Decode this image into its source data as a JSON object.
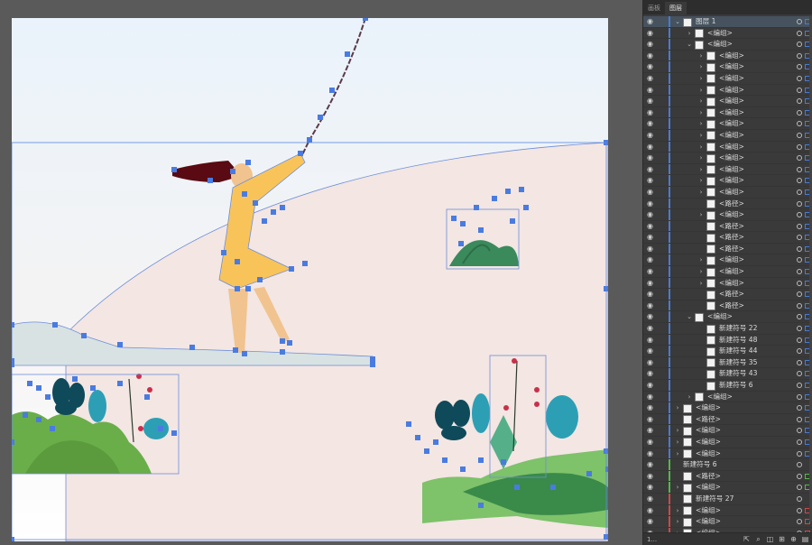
{
  "panel": {
    "tabs": [
      {
        "label": "画板",
        "active": false
      },
      {
        "label": "图层",
        "active": true
      }
    ],
    "footer": {
      "count": "1...",
      "icons": [
        "export-icon",
        "search-icon",
        "clipping-mask-icon",
        "sublayer-icon",
        "new-layer-icon",
        "delete-icon"
      ]
    }
  },
  "layers": [
    {
      "name": "图层 1",
      "indent": 0,
      "expand": "open",
      "thumb": true,
      "sel": true,
      "color": "#4a7bd0",
      "selcolor": "#4a7bd0"
    },
    {
      "name": "<编组>",
      "indent": 1,
      "expand": "closed",
      "thumb": true,
      "color": "#4a7bd0",
      "selcolor": "#4a7bd0"
    },
    {
      "name": "<编组>",
      "indent": 1,
      "expand": "open",
      "thumb": true,
      "color": "#4a7bd0",
      "selcolor": "#4a7bd0"
    },
    {
      "name": "<编组>",
      "indent": 2,
      "expand": "closed",
      "thumb": true,
      "color": "#4a7bd0",
      "selcolor": "#4a7bd0"
    },
    {
      "name": "<编组>",
      "indent": 2,
      "expand": "closed",
      "thumb": true,
      "color": "#4a7bd0",
      "selcolor": "#4a7bd0"
    },
    {
      "name": "<编组>",
      "indent": 2,
      "expand": "closed",
      "thumb": true,
      "color": "#4a7bd0",
      "selcolor": "#4a7bd0"
    },
    {
      "name": "<编组>",
      "indent": 2,
      "expand": "closed",
      "thumb": true,
      "color": "#4a7bd0",
      "selcolor": "#4a7bd0"
    },
    {
      "name": "<编组>",
      "indent": 2,
      "expand": "closed",
      "thumb": true,
      "color": "#4a7bd0",
      "selcolor": "#4a7bd0"
    },
    {
      "name": "<编组>",
      "indent": 2,
      "expand": "closed",
      "thumb": true,
      "color": "#4a7bd0",
      "selcolor": "#4a7bd0"
    },
    {
      "name": "<编组>",
      "indent": 2,
      "expand": "closed",
      "thumb": true,
      "color": "#4a7bd0",
      "selcolor": "#4a7bd0"
    },
    {
      "name": "<编组>",
      "indent": 2,
      "expand": "closed",
      "thumb": true,
      "color": "#4a7bd0",
      "selcolor": "#4a7bd0"
    },
    {
      "name": "<编组>",
      "indent": 2,
      "expand": "closed",
      "thumb": true,
      "color": "#4a7bd0",
      "selcolor": "#4a7bd0"
    },
    {
      "name": "<编组>",
      "indent": 2,
      "expand": "closed",
      "thumb": true,
      "color": "#4a7bd0",
      "selcolor": "#4a7bd0"
    },
    {
      "name": "<编组>",
      "indent": 2,
      "expand": "closed",
      "thumb": true,
      "color": "#4a7bd0",
      "selcolor": "#4a7bd0"
    },
    {
      "name": "<编组>",
      "indent": 2,
      "expand": "closed",
      "thumb": true,
      "color": "#4a7bd0",
      "selcolor": "#4a7bd0"
    },
    {
      "name": "<编组>",
      "indent": 2,
      "expand": "closed",
      "thumb": true,
      "color": "#4a7bd0",
      "selcolor": "#4a7bd0"
    },
    {
      "name": "<路径>",
      "indent": 2,
      "expand": "none",
      "thumb": true,
      "color": "#4a7bd0",
      "selcolor": "#4a7bd0"
    },
    {
      "name": "<编组>",
      "indent": 2,
      "expand": "closed",
      "thumb": true,
      "color": "#4a7bd0",
      "selcolor": "#4a7bd0"
    },
    {
      "name": "<路径>",
      "indent": 2,
      "expand": "none",
      "thumb": true,
      "color": "#4a7bd0",
      "selcolor": "#4a7bd0"
    },
    {
      "name": "<路径>",
      "indent": 2,
      "expand": "none",
      "thumb": true,
      "color": "#4a7bd0",
      "selcolor": "#4a7bd0"
    },
    {
      "name": "<路径>",
      "indent": 2,
      "expand": "none",
      "thumb": true,
      "color": "#4a7bd0",
      "selcolor": "#4a7bd0"
    },
    {
      "name": "<编组>",
      "indent": 2,
      "expand": "closed",
      "thumb": true,
      "color": "#4a7bd0",
      "selcolor": "#4a7bd0"
    },
    {
      "name": "<编组>",
      "indent": 2,
      "expand": "closed",
      "thumb": true,
      "color": "#4a7bd0",
      "selcolor": "#4a7bd0"
    },
    {
      "name": "<编组>",
      "indent": 2,
      "expand": "closed",
      "thumb": true,
      "color": "#4a7bd0",
      "selcolor": "#4a7bd0"
    },
    {
      "name": "<路径>",
      "indent": 2,
      "expand": "none",
      "thumb": true,
      "color": "#4a7bd0",
      "selcolor": "#4a7bd0"
    },
    {
      "name": "<路径>",
      "indent": 2,
      "expand": "none",
      "thumb": true,
      "color": "#4a7bd0",
      "selcolor": "#4a7bd0"
    },
    {
      "name": "<编组>",
      "indent": 1,
      "expand": "open",
      "thumb": true,
      "color": "#4a7bd0",
      "selcolor": "#4a7bd0"
    },
    {
      "name": "新建符号 22",
      "indent": 2,
      "expand": "none",
      "thumb": true,
      "color": "#4a7bd0",
      "selcolor": "#4a7bd0"
    },
    {
      "name": "新建符号 48",
      "indent": 2,
      "expand": "none",
      "thumb": true,
      "color": "#4a7bd0",
      "selcolor": "#4a7bd0"
    },
    {
      "name": "新建符号 44",
      "indent": 2,
      "expand": "none",
      "thumb": true,
      "color": "#4a7bd0",
      "selcolor": "#4a7bd0"
    },
    {
      "name": "新建符号 35",
      "indent": 2,
      "expand": "none",
      "thumb": true,
      "color": "#4a7bd0",
      "selcolor": "#4a7bd0"
    },
    {
      "name": "新建符号 43",
      "indent": 2,
      "expand": "none",
      "thumb": true,
      "color": "#4a7bd0",
      "selcolor": "#4a7bd0"
    },
    {
      "name": "新建符号 6",
      "indent": 2,
      "expand": "none",
      "thumb": true,
      "color": "#4a7bd0",
      "selcolor": "#4a7bd0"
    },
    {
      "name": "<编组>",
      "indent": 1,
      "expand": "closed",
      "thumb": true,
      "color": "#4a7bd0",
      "selcolor": "#4a7bd0"
    },
    {
      "name": "<编组>",
      "indent": 0,
      "expand": "closed",
      "thumb": true,
      "color": "#4a7bd0",
      "selcolor": "#4a7bd0"
    },
    {
      "name": "<路径>",
      "indent": 0,
      "expand": "none",
      "thumb": true,
      "color": "#4a7bd0",
      "selcolor": "#4a7bd0"
    },
    {
      "name": "<编组>",
      "indent": 0,
      "expand": "closed",
      "thumb": true,
      "color": "#4a7bd0",
      "selcolor": "#4a7bd0"
    },
    {
      "name": "<编组>",
      "indent": 0,
      "expand": "closed",
      "thumb": true,
      "color": "#4a7bd0",
      "selcolor": "#4a7bd0"
    },
    {
      "name": "<编组>",
      "indent": 0,
      "expand": "closed",
      "thumb": true,
      "color": "#4a7bd0",
      "selcolor": "#4a7bd0"
    },
    {
      "name": "新建符号 6",
      "indent": 0,
      "expand": "none",
      "thumb": false,
      "color": "#54b948",
      "selcolor": ""
    },
    {
      "name": "<路径>",
      "indent": 0,
      "expand": "none",
      "thumb": true,
      "color": "#54b948",
      "selcolor": "#54b948"
    },
    {
      "name": "<编组>",
      "indent": 0,
      "expand": "closed",
      "thumb": true,
      "color": "#54b948",
      "selcolor": "#54b948"
    },
    {
      "name": "新建符号 27",
      "indent": 0,
      "expand": "none",
      "thumb": true,
      "color": "#d04848",
      "selcolor": ""
    },
    {
      "name": "<编组>",
      "indent": 0,
      "expand": "closed",
      "thumb": true,
      "color": "#d04848",
      "selcolor": "#d04848"
    },
    {
      "name": "<编组>",
      "indent": 0,
      "expand": "closed",
      "thumb": true,
      "color": "#d04848",
      "selcolor": "#d04848"
    },
    {
      "name": "<编组>",
      "indent": 0,
      "expand": "closed",
      "thumb": true,
      "color": "#d04848",
      "selcolor": "#d04848"
    }
  ]
}
